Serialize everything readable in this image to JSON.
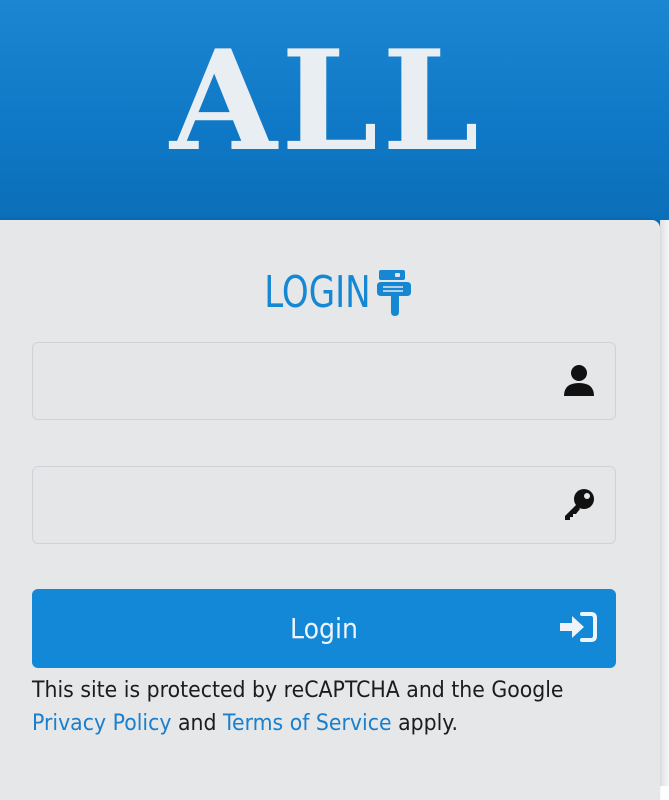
{
  "header": {
    "title": "ALL"
  },
  "login": {
    "heading": "LOGIN",
    "username": {
      "value": "",
      "placeholder": "",
      "icon": "user-icon"
    },
    "password": {
      "value": "",
      "placeholder": "",
      "icon": "key-icon"
    },
    "button_label": "Login",
    "button_icon": "sign-in-icon",
    "heading_icon": "hand-pointing-down-icon"
  },
  "recaptcha": {
    "line1": "This site is protected by reCAPTCHA and the Google",
    "privacy_link": "Privacy Policy",
    "and_text": "and",
    "terms_link": "Terms of Service",
    "apply_text": "apply."
  },
  "colors": {
    "brand_blue": "#1388d6",
    "header_blue": "#0f78c6",
    "heading_blue": "#1687d3",
    "card_bg": "#e6e7e9",
    "header_text": "#e9eef2"
  }
}
